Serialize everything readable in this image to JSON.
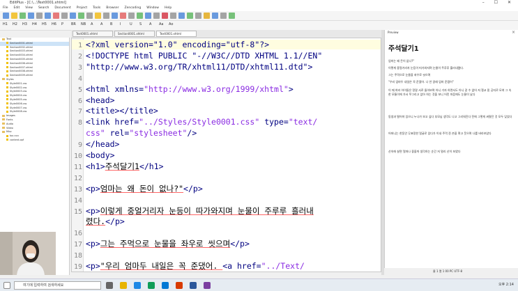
{
  "window": {
    "title": "EditPlus - [C:\\...\\Text0001.xhtml]",
    "controls": "– ☐ ✕"
  },
  "menu": [
    "File",
    "Edit",
    "View",
    "Search",
    "Document",
    "Project",
    "Tools",
    "Browser",
    "Zencoding",
    "Window",
    "Help"
  ],
  "html_toolbar": [
    "H1",
    "H2",
    "H3",
    "H4",
    "H5",
    "H6",
    "P",
    "BR",
    "NB",
    "A",
    "A",
    "B",
    "I",
    "U",
    "S",
    "A",
    "Aa",
    "Ao"
  ],
  "sidebar": {
    "items": [
      {
        "type": "dir",
        "label": "Text"
      },
      {
        "type": "file",
        "label": "Section0001.xhtml"
      },
      {
        "type": "file",
        "label": "Section0002.xhtml"
      },
      {
        "type": "file",
        "label": "Section0003.xhtml"
      },
      {
        "type": "file",
        "label": "Section0004.xhtml"
      },
      {
        "type": "file",
        "label": "Section0005.xhtml"
      },
      {
        "type": "file",
        "label": "Section0006.xhtml"
      },
      {
        "type": "file",
        "label": "Section0007.xhtml"
      },
      {
        "type": "file",
        "label": "Section0008.xhtml"
      },
      {
        "type": "file",
        "label": "Section0009.xhtml"
      },
      {
        "type": "dir",
        "label": "Styles"
      },
      {
        "type": "file",
        "label": "Style0001.css"
      },
      {
        "type": "file",
        "label": "Style0002.css"
      },
      {
        "type": "file",
        "label": "Style0003.css"
      },
      {
        "type": "file",
        "label": "Style0004.css"
      },
      {
        "type": "file",
        "label": "Style0005.css"
      },
      {
        "type": "file",
        "label": "Style0006.css"
      },
      {
        "type": "file",
        "label": "Style0007.css"
      },
      {
        "type": "file",
        "label": "Style0008.css"
      },
      {
        "type": "dir",
        "label": "Images"
      },
      {
        "type": "dir",
        "label": "Fonts"
      },
      {
        "type": "dir",
        "label": "Audio"
      },
      {
        "type": "dir",
        "label": "Video"
      },
      {
        "type": "dir",
        "label": "Misc"
      },
      {
        "type": "file",
        "label": "toc.ncx"
      },
      {
        "type": "file",
        "label": "content.opf"
      }
    ]
  },
  "tabs": [
    {
      "label": "Text0001.xhtml",
      "active": false
    },
    {
      "label": "Section0001.xhtml",
      "active": false
    },
    {
      "label": "Text0001.xhtml",
      "active": true
    }
  ],
  "editor": {
    "lines": [
      {
        "n": "1",
        "parts": [
          {
            "c": "tag",
            "t": "<?xml version=\"1.0\" encoding=\"utf-8\"?>"
          }
        ]
      },
      {
        "n": "2",
        "parts": [
          {
            "c": "tag",
            "t": "<!DOCTYPE html PUBLIC \"-//W3C//DTD XHTML 1.1//EN\""
          }
        ]
      },
      {
        "n": "3",
        "parts": [
          {
            "c": "tag",
            "t": "  \"http://www.w3.org/TR/xhtml11/DTD/xhtml11.dtd\">"
          }
        ]
      },
      {
        "n": "4",
        "parts": []
      },
      {
        "n": "5",
        "parts": [
          {
            "c": "tag",
            "t": "<html xmlns="
          },
          {
            "c": "str",
            "t": "\"http://www.w3.org/1999/xhtml\""
          },
          {
            "c": "tag",
            "t": ">"
          }
        ]
      },
      {
        "n": "6",
        "parts": [
          {
            "c": "tag",
            "t": "<head>"
          }
        ]
      },
      {
        "n": "7",
        "parts": [
          {
            "c": "tag",
            "t": "<title></title>"
          }
        ]
      },
      {
        "n": "8",
        "parts": [
          {
            "c": "tag",
            "t": "<link href="
          },
          {
            "c": "str",
            "t": "\"../Styles/Style0001.css\""
          },
          {
            "c": "tag",
            "t": " type="
          },
          {
            "c": "str",
            "t": "\"text/"
          }
        ]
      },
      {
        "n": "",
        "parts": [
          {
            "c": "str",
            "t": "css\""
          },
          {
            "c": "tag",
            "t": " rel="
          },
          {
            "c": "str",
            "t": "\"stylesheet\""
          },
          {
            "c": "tag",
            "t": "/>"
          }
        ]
      },
      {
        "n": "9",
        "parts": [
          {
            "c": "tag",
            "t": "</head>"
          }
        ]
      },
      {
        "n": "10",
        "parts": [
          {
            "c": "tag",
            "t": "<body>"
          }
        ]
      },
      {
        "n": "11",
        "parts": [
          {
            "c": "tag",
            "t": "<h1>"
          },
          {
            "c": "txt",
            "t": "주석달기1"
          },
          {
            "c": "tag",
            "t": "</h1>"
          }
        ]
      },
      {
        "n": "12",
        "parts": []
      },
      {
        "n": "13",
        "parts": [
          {
            "c": "tag",
            "t": "<p>"
          },
          {
            "c": "txt",
            "t": "엄마는 왜 돈이 없나?\""
          },
          {
            "c": "tag",
            "t": "</p>"
          }
        ]
      },
      {
        "n": "14",
        "parts": []
      },
      {
        "n": "15",
        "parts": [
          {
            "c": "tag",
            "t": "<p>"
          },
          {
            "c": "txt",
            "t": "이렇게 중얼거리자 눈등이 따가와지며 눈물이 주루루 흘러내"
          }
        ]
      },
      {
        "n": "",
        "parts": [
          {
            "c": "txt",
            "t": "렸다."
          },
          {
            "c": "tag",
            "t": "</p>"
          }
        ]
      },
      {
        "n": "16",
        "parts": []
      },
      {
        "n": "17",
        "parts": [
          {
            "c": "tag",
            "t": "<p>"
          },
          {
            "c": "txt",
            "t": "그는 주먹으로 눈물을 좌우로 씻으며"
          },
          {
            "c": "tag",
            "t": "</p>"
          }
        ]
      },
      {
        "n": "18",
        "parts": []
      },
      {
        "n": "19",
        "parts": [
          {
            "c": "tag",
            "t": "<p>"
          },
          {
            "c": "txt",
            "t": "\"우리 엄마두 내일은 꼭 준댔어. "
          },
          {
            "c": "tag",
            "t": "<a href="
          },
          {
            "c": "str",
            "t": "\"../Text/"
          }
        ]
      }
    ]
  },
  "preview": {
    "tab_label": "Preview",
    "title": "주석달기1",
    "paragraphs": [
      "엄마는 왜 돈이 없나?\"",
      "이렇게 중얼거리자 눈등이 따가와지며 눈물이 주루루 흘러내렸다.",
      "그는 주먹으로 눈물을 좌우로 씻으며",
      "\"우리 엄마두 내일은 꼭 준댔어. 나 안 갈래 엄마 준댔어\"",
      "이 때 여러 아이들은 정말 서로 돌아보며 아니 가자 하면서도 아니 갈 수 없어 저 철교 밑 공지로 모여 그 속 한 모퉁이에 가서 쭈그리고 앉아 하는 것을 보니 어린 마음에도 눈물이 났다",
      "동생과 떨어져 있으니 누나가 보고 싶다 부모님 생각도 나고 그리워진다 전에 그렇게 싸웠던 것 모두 잊었다",
      "어머니는 한동안 무표정한 얼굴로 있다가 이내 주먹 쥔 손을 펴고 웃으며 나를 바라보았다",
      "산속에 살면 얼마나 좋을까 생각하는 순간 저 멀리 산이 보였다"
    ]
  },
  "status": {
    "text": "줄 1 열 1  00  PC  UTF-8"
  },
  "taskbar": {
    "search_placeholder": "여기에 입력하여 검색하세요",
    "clock": "오후 2:14"
  }
}
